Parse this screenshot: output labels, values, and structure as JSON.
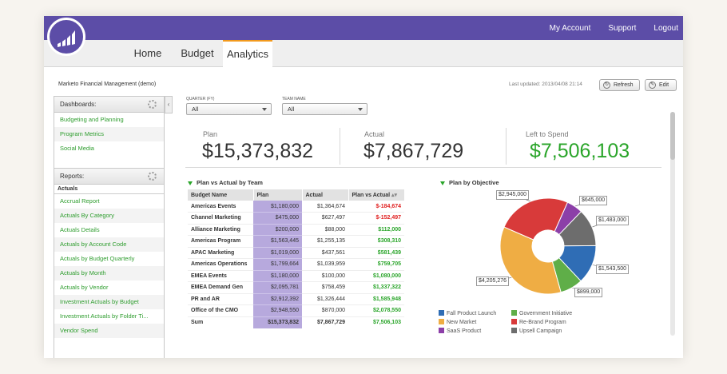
{
  "topbar": {
    "links": [
      "My Account",
      "Support",
      "Logout"
    ]
  },
  "nav": {
    "tabs": [
      "Home",
      "Budget",
      "Analytics"
    ],
    "active": "Analytics"
  },
  "app_title": "Marketo Financial Management (demo)",
  "last_updated": "Last updated: 2013/04/08 21:14",
  "buttons": {
    "refresh": "Refresh",
    "edit": "Edit"
  },
  "sidebar": {
    "dashboards_label": "Dashboards:",
    "dashboards": [
      "Budgeting and Planning",
      "Program Metrics",
      "Social Media"
    ],
    "reports_label": "Reports:",
    "actuals_label": "Actuals",
    "reports": [
      "Accrual Report",
      "Actuals By Category",
      "Actuals Details",
      "Actuals by Account Code",
      "Actuals by Budget Quarterly",
      "Actuals by Month",
      "Actuals by Vendor",
      "Investment Actuals by Budget",
      "Investment Actuals by Folder Ti...",
      "Vendor Spend"
    ]
  },
  "filters": {
    "quarter_label": "QUARTER (FY)",
    "quarter_value": "All",
    "team_label": "TEAM NAME",
    "team_value": "All"
  },
  "kpis": [
    {
      "label": "Plan",
      "value": "$15,373,832"
    },
    {
      "label": "Actual",
      "value": "$7,867,729"
    },
    {
      "label": "Left to Spend",
      "value": "$7,506,103"
    }
  ],
  "table": {
    "title": "Plan vs Actual by Team",
    "headers": [
      "Budget Name",
      "Plan",
      "Actual",
      "Plan vs Actual"
    ],
    "rows": [
      [
        "Americas Events",
        "$1,180,000",
        "$1,364,674",
        "$-184,674"
      ],
      [
        "Channel Marketing",
        "$475,000",
        "$627,497",
        "$-152,497"
      ],
      [
        "Alliance Marketing",
        "$200,000",
        "$88,000",
        "$112,000"
      ],
      [
        "Americas Program",
        "$1,563,445",
        "$1,255,135",
        "$308,310"
      ],
      [
        "APAC Marketing",
        "$1,019,000",
        "$437,561",
        "$581,439"
      ],
      [
        "Americas Operations",
        "$1,799,664",
        "$1,039,959",
        "$759,705"
      ],
      [
        "EMEA Events",
        "$1,180,000",
        "$100,000",
        "$1,080,000"
      ],
      [
        "EMEA Demand Gen",
        "$2,095,781",
        "$758,459",
        "$1,337,322"
      ],
      [
        "PR and AR",
        "$2,912,392",
        "$1,326,444",
        "$1,585,948"
      ],
      [
        "Office of the CMO",
        "$2,948,550",
        "$870,000",
        "$2,078,550"
      ]
    ],
    "sum": [
      "Sum",
      "$15,373,832",
      "$7,867,729",
      "$7,506,103"
    ]
  },
  "chart_data": {
    "type": "pie",
    "title": "Plan by Objective",
    "series": [
      {
        "name": "Fall Product Launch",
        "value": 1543500,
        "label": "$1,543,500",
        "color": "#2f6db5"
      },
      {
        "name": "Government Initiative",
        "value": 899000,
        "label": "$899,000",
        "color": "#5fae48"
      },
      {
        "name": "New Market",
        "value": 4205276,
        "label": "$4,205,276",
        "color": "#efad44"
      },
      {
        "name": "Re-Brand Program",
        "value": 2945000,
        "label": "$2,945,000",
        "color": "#d83a3a"
      },
      {
        "name": "SaaS Product",
        "value": 645000,
        "label": "$645,000",
        "color": "#8c3fa8"
      },
      {
        "name": "Upsell Campaign",
        "value": 1483000,
        "label": "$1,483,000",
        "color": "#6d6d6d"
      }
    ],
    "legend_order": [
      "Fall Product Launch",
      "Government Initiative",
      "New Market",
      "Re-Brand Program",
      "SaaS Product",
      "Upsell Campaign"
    ]
  }
}
